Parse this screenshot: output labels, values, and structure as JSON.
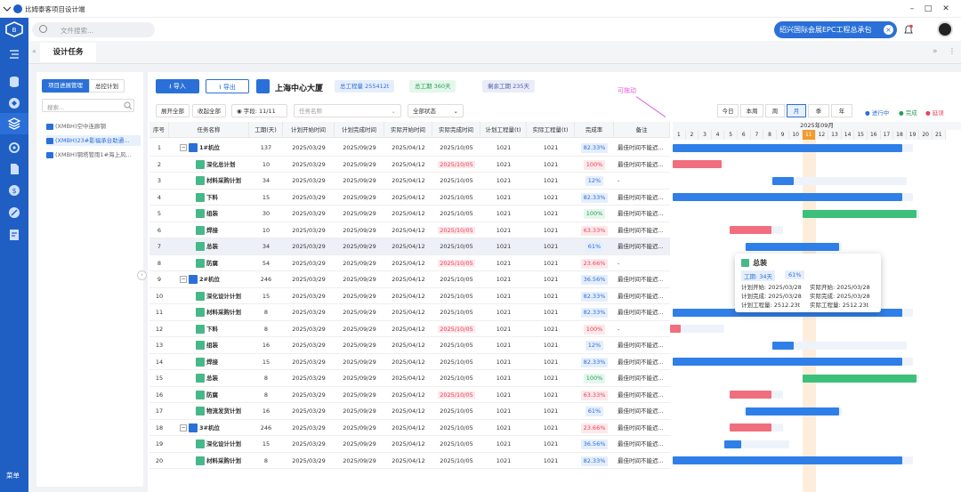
{
  "app": {
    "title": "比姆泰客项目设计端"
  },
  "header": {
    "search_placeholder": "文件搜索...",
    "project": "绍兴国际会展EPC工程总承包",
    "pill_close": "×"
  },
  "sidebar": {
    "menu_label": "菜单"
  },
  "tabs": {
    "active": "设计任务"
  },
  "left_panel": {
    "btn_progress": "项目进展管理",
    "btn_master": "总控计划",
    "search_placeholder": "搜索...",
    "items": [
      "(XMBH)空中连廊钢",
      "(XMBH)23#影福承台助通...",
      "(XMBH)钢塔管雨1#海上风..."
    ]
  },
  "toolbar": {
    "import": "导入",
    "export": "导出",
    "project_name": "上海中心大厦",
    "stat_total": "总工程量 255412t",
    "stat_duration": "总工期 360天",
    "stat_remaining": "剩余工期 235天",
    "drag_hint": "可拖动"
  },
  "filters": {
    "expand_all": "展开全部",
    "collapse_all": "收起全部",
    "fields": "字段: 11/11",
    "task_name_placeholder": "任务名称",
    "status": "全部状态",
    "views": [
      "今日",
      "本周",
      "周",
      "月",
      "季",
      "年"
    ],
    "active_view": "月",
    "legend": [
      {
        "label": "进行中",
        "color": "#2a70d8"
      },
      {
        "label": "完成",
        "color": "#2a9d55"
      },
      {
        "label": "延误",
        "color": "#e8435a"
      }
    ]
  },
  "columns": [
    "序号",
    "任务名称",
    "工期(天)",
    "计划开始时间",
    "计划完成时间",
    "实际开始时间",
    "实际完成时间",
    "计划工程量(t)",
    "实际工程量(t)",
    "完成率",
    "备注"
  ],
  "rows": [
    {
      "no": "1",
      "name": "1#机位",
      "level": 0,
      "dur": "137",
      "ps": "2025/03/29",
      "pe": "2025/09/29",
      "as": "2025/04/12",
      "ae": "2025/10/05",
      "late": false,
      "pq": "1021",
      "aq": "1021",
      "pct": "82.33%",
      "pc": "b",
      "note": "最佳时间不能迟..."
    },
    {
      "no": "2",
      "name": "深化总计划",
      "level": 1,
      "dur": "10",
      "ps": "2025/03/29",
      "pe": "2025/09/29",
      "as": "2025/04/12",
      "ae": "2025/10/05",
      "late": true,
      "pq": "1021",
      "aq": "1021",
      "pct": "100%",
      "pc": "r",
      "note": "最佳时间不能迟..."
    },
    {
      "no": "3",
      "name": "材料采购计划",
      "level": 1,
      "dur": "34",
      "ps": "2025/03/29",
      "pe": "2025/09/29",
      "as": "2025/04/12",
      "ae": "2025/10/05",
      "late": false,
      "pq": "1021",
      "aq": "1021",
      "pct": "12%",
      "pc": "b",
      "note": "-"
    },
    {
      "no": "4",
      "name": "下料",
      "level": 1,
      "dur": "15",
      "ps": "2025/03/29",
      "pe": "2025/09/29",
      "as": "2025/04/12",
      "ae": "2025/10/05",
      "late": false,
      "pq": "1021",
      "aq": "1021",
      "pct": "82.33%",
      "pc": "b",
      "note": "最佳时间不能迟..."
    },
    {
      "no": "5",
      "name": "组装",
      "level": 1,
      "dur": "30",
      "ps": "2025/03/29",
      "pe": "2025/09/29",
      "as": "2025/04/12",
      "ae": "2025/10/05",
      "late": false,
      "pq": "1021",
      "aq": "1021",
      "pct": "100%",
      "pc": "g",
      "note": "最佳时间不能迟..."
    },
    {
      "no": "6",
      "name": "焊接",
      "level": 1,
      "dur": "10",
      "ps": "2025/03/29",
      "pe": "2025/09/29",
      "as": "2025/04/12",
      "ae": "2025/10/05",
      "late": true,
      "pq": "1021",
      "aq": "1021",
      "pct": "63.33%",
      "pc": "r",
      "note": "最佳时间不能迟..."
    },
    {
      "no": "7",
      "name": "总装",
      "level": 1,
      "dur": "34",
      "ps": "2025/03/29",
      "pe": "2025/09/29",
      "as": "2025/04/12",
      "ae": "2025/10/05",
      "late": false,
      "pq": "1021",
      "aq": "1021",
      "pct": "61%",
      "pc": "b",
      "note": "最佳时间不能迟..."
    },
    {
      "no": "8",
      "name": "防腐",
      "level": 1,
      "dur": "54",
      "ps": "2025/03/29",
      "pe": "2025/09/29",
      "as": "2025/04/12",
      "ae": "2025/10/05",
      "late": true,
      "pq": "1021",
      "aq": "1021",
      "pct": "23.66%",
      "pc": "r",
      "note": "-"
    },
    {
      "no": "9",
      "name": "2#机位",
      "level": 0,
      "dur": "246",
      "ps": "2025/03/29",
      "pe": "2025/09/29",
      "as": "2025/04/12",
      "ae": "2025/10/05",
      "late": false,
      "pq": "1021",
      "aq": "1021",
      "pct": "36.56%",
      "pc": "b",
      "note": "最佳时间不能迟..."
    },
    {
      "no": "10",
      "name": "深化设计计划",
      "level": 1,
      "dur": "15",
      "ps": "2025/03/29",
      "pe": "2025/09/29",
      "as": "2025/04/12",
      "ae": "2025/10/05",
      "late": false,
      "pq": "1021",
      "aq": "1021",
      "pct": "82.33%",
      "pc": "b",
      "note": "最佳时间不能迟..."
    },
    {
      "no": "11",
      "name": "材料采购计划",
      "level": 1,
      "dur": "8",
      "ps": "2025/03/29",
      "pe": "2025/09/29",
      "as": "2025/04/12",
      "ae": "2025/10/05",
      "late": false,
      "pq": "1021",
      "aq": "1021",
      "pct": "82.33%",
      "pc": "b",
      "note": "最佳时间不能迟..."
    },
    {
      "no": "12",
      "name": "下料",
      "level": 1,
      "dur": "8",
      "ps": "2025/03/29",
      "pe": "2025/09/29",
      "as": "2025/04/12",
      "ae": "2025/10/05",
      "late": true,
      "pq": "1021",
      "aq": "1021",
      "pct": "100%",
      "pc": "r",
      "note": "-"
    },
    {
      "no": "13",
      "name": "组装",
      "level": 1,
      "dur": "16",
      "ps": "2025/03/29",
      "pe": "2025/09/29",
      "as": "2025/04/12",
      "ae": "2025/10/05",
      "late": false,
      "pq": "1021",
      "aq": "1021",
      "pct": "12%",
      "pc": "b",
      "note": "最佳时间不能迟..."
    },
    {
      "no": "14",
      "name": "焊接",
      "level": 1,
      "dur": "15",
      "ps": "2025/03/29",
      "pe": "2025/09/29",
      "as": "2025/04/12",
      "ae": "2025/10/05",
      "late": false,
      "pq": "1021",
      "aq": "1021",
      "pct": "82.33%",
      "pc": "b",
      "note": "最佳时间不能迟..."
    },
    {
      "no": "15",
      "name": "总装",
      "level": 1,
      "dur": "8",
      "ps": "2025/03/29",
      "pe": "2025/09/29",
      "as": "2025/04/12",
      "ae": "2025/10/05",
      "late": false,
      "pq": "1021",
      "aq": "1021",
      "pct": "100%",
      "pc": "g",
      "note": "最佳时间不能迟..."
    },
    {
      "no": "16",
      "name": "防腐",
      "level": 1,
      "dur": "8",
      "ps": "2025/03/29",
      "pe": "2025/09/29",
      "as": "2025/04/12",
      "ae": "2025/10/05",
      "late": true,
      "pq": "1021",
      "aq": "1021",
      "pct": "63.33%",
      "pc": "r",
      "note": "最佳时间不能迟..."
    },
    {
      "no": "17",
      "name": "物流发货计划",
      "level": 1,
      "dur": "16",
      "ps": "2025/03/29",
      "pe": "2025/09/29",
      "as": "2025/04/12",
      "ae": "2025/10/05",
      "late": false,
      "pq": "1021",
      "aq": "1021",
      "pct": "61%",
      "pc": "b",
      "note": "最佳时间不能迟..."
    },
    {
      "no": "18",
      "name": "3#机位",
      "level": 0,
      "dur": "246",
      "ps": "2025/03/29",
      "pe": "2025/09/29",
      "as": "2025/04/12",
      "ae": "2025/10/05",
      "late": false,
      "pq": "1021",
      "aq": "1021",
      "pct": "23.66%",
      "pc": "r",
      "note": "最佳时间不能迟..."
    },
    {
      "no": "19",
      "name": "深化设计计划",
      "level": 1,
      "dur": "15",
      "ps": "2025/03/29",
      "pe": "2025/09/29",
      "as": "2025/04/12",
      "ae": "2025/10/05",
      "late": false,
      "pq": "1021",
      "aq": "1021",
      "pct": "36.56%",
      "pc": "b",
      "note": "最佳时间不能迟..."
    },
    {
      "no": "20",
      "name": "材料采购计划",
      "level": 1,
      "dur": "8",
      "ps": "2025/03/29",
      "pe": "2025/09/29",
      "as": "2025/04/12",
      "ae": "2025/10/05",
      "late": false,
      "pq": "1021",
      "aq": "1021",
      "pct": "82.33%",
      "pc": "b",
      "note": "最佳时间不能迟..."
    }
  ],
  "gantt": {
    "month": "2025年09月",
    "today_day": "11",
    "days": [
      "1",
      "2",
      "3",
      "4",
      "5",
      "6",
      "7",
      "8",
      "9",
      "10",
      "11",
      "12",
      "13",
      "14",
      "15",
      "16",
      "17",
      "18",
      "19",
      "20",
      "21"
    ],
    "bars": [
      {
        "s": 1,
        "e": 18.7,
        "c": "blue",
        "plan": [
          1,
          19.5
        ]
      },
      {
        "s": 1,
        "e": 4.8,
        "c": "red",
        "plan": [
          1,
          5
        ]
      },
      {
        "s": 8.7,
        "e": 10.3,
        "c": "blue",
        "plan": [
          8.5,
          19
        ]
      },
      {
        "s": 1,
        "e": 18.7,
        "c": "blue",
        "plan": [
          1,
          19.5
        ]
      },
      {
        "s": 11,
        "e": 19.8,
        "c": "green",
        "plan": [
          11,
          20
        ]
      },
      {
        "s": 5.4,
        "e": 8.6,
        "c": "red",
        "plan": [
          5.5,
          9.5
        ]
      },
      {
        "s": 6.6,
        "e": 13.8,
        "c": "blue",
        "plan": [
          6.5,
          14
        ]
      },
      {
        "s": 0,
        "e": 0,
        "c": "blue",
        "plan": [
          1,
          1
        ]
      },
      {
        "s": 5,
        "e": 5,
        "c": "blue",
        "plan": [
          1,
          1
        ]
      },
      {
        "s": 0,
        "e": 0,
        "c": "blue",
        "plan": [
          1,
          1
        ]
      },
      {
        "s": 1,
        "e": 18.7,
        "c": "blue",
        "plan": [
          1,
          19.5
        ]
      },
      {
        "s": 0,
        "e": 0.8,
        "c": "red",
        "plan": [
          1,
          5
        ]
      },
      {
        "s": 8.7,
        "e": 10.3,
        "c": "blue",
        "plan": [
          8.5,
          19
        ]
      },
      {
        "s": 1,
        "e": 18.7,
        "c": "blue",
        "plan": [
          1,
          19.5
        ]
      },
      {
        "s": 11,
        "e": 19.8,
        "c": "green",
        "plan": [
          11,
          20
        ]
      },
      {
        "s": 5.4,
        "e": 8.6,
        "c": "red",
        "plan": [
          5.5,
          9.5
        ]
      },
      {
        "s": 6.6,
        "e": 13.8,
        "c": "blue",
        "plan": [
          6.5,
          14
        ]
      },
      {
        "s": 5.4,
        "e": 8.6,
        "c": "red",
        "plan": [
          5.5,
          9.5
        ]
      },
      {
        "s": 5,
        "e": 6.3,
        "c": "blue",
        "plan": [
          5,
          10
        ]
      },
      {
        "s": 1,
        "e": 18.7,
        "c": "blue",
        "plan": [
          1,
          19.5
        ]
      },
      {
        "s": 0,
        "e": 0,
        "c": "blue",
        "plan": [
          1,
          1
        ]
      }
    ]
  },
  "tooltip": {
    "title": "总装",
    "dur": "工期: 34天",
    "pct": "61%",
    "plan_start": "计划开始: 2025/03/28",
    "actual_start": "实际开始: 2025/03/28",
    "plan_end": "计划完成: 2025/03/28",
    "actual_end": "实际完成: 2025/03/28",
    "plan_qty": "计划工程量: 2512.23t",
    "actual_qty": "实际工程量: 2512.23t"
  },
  "colors": {
    "brand": "#1f5fc3",
    "accent": "#2a70d8",
    "late": "#e8435a",
    "done": "#2a9d55",
    "today": "#f29b2e"
  }
}
